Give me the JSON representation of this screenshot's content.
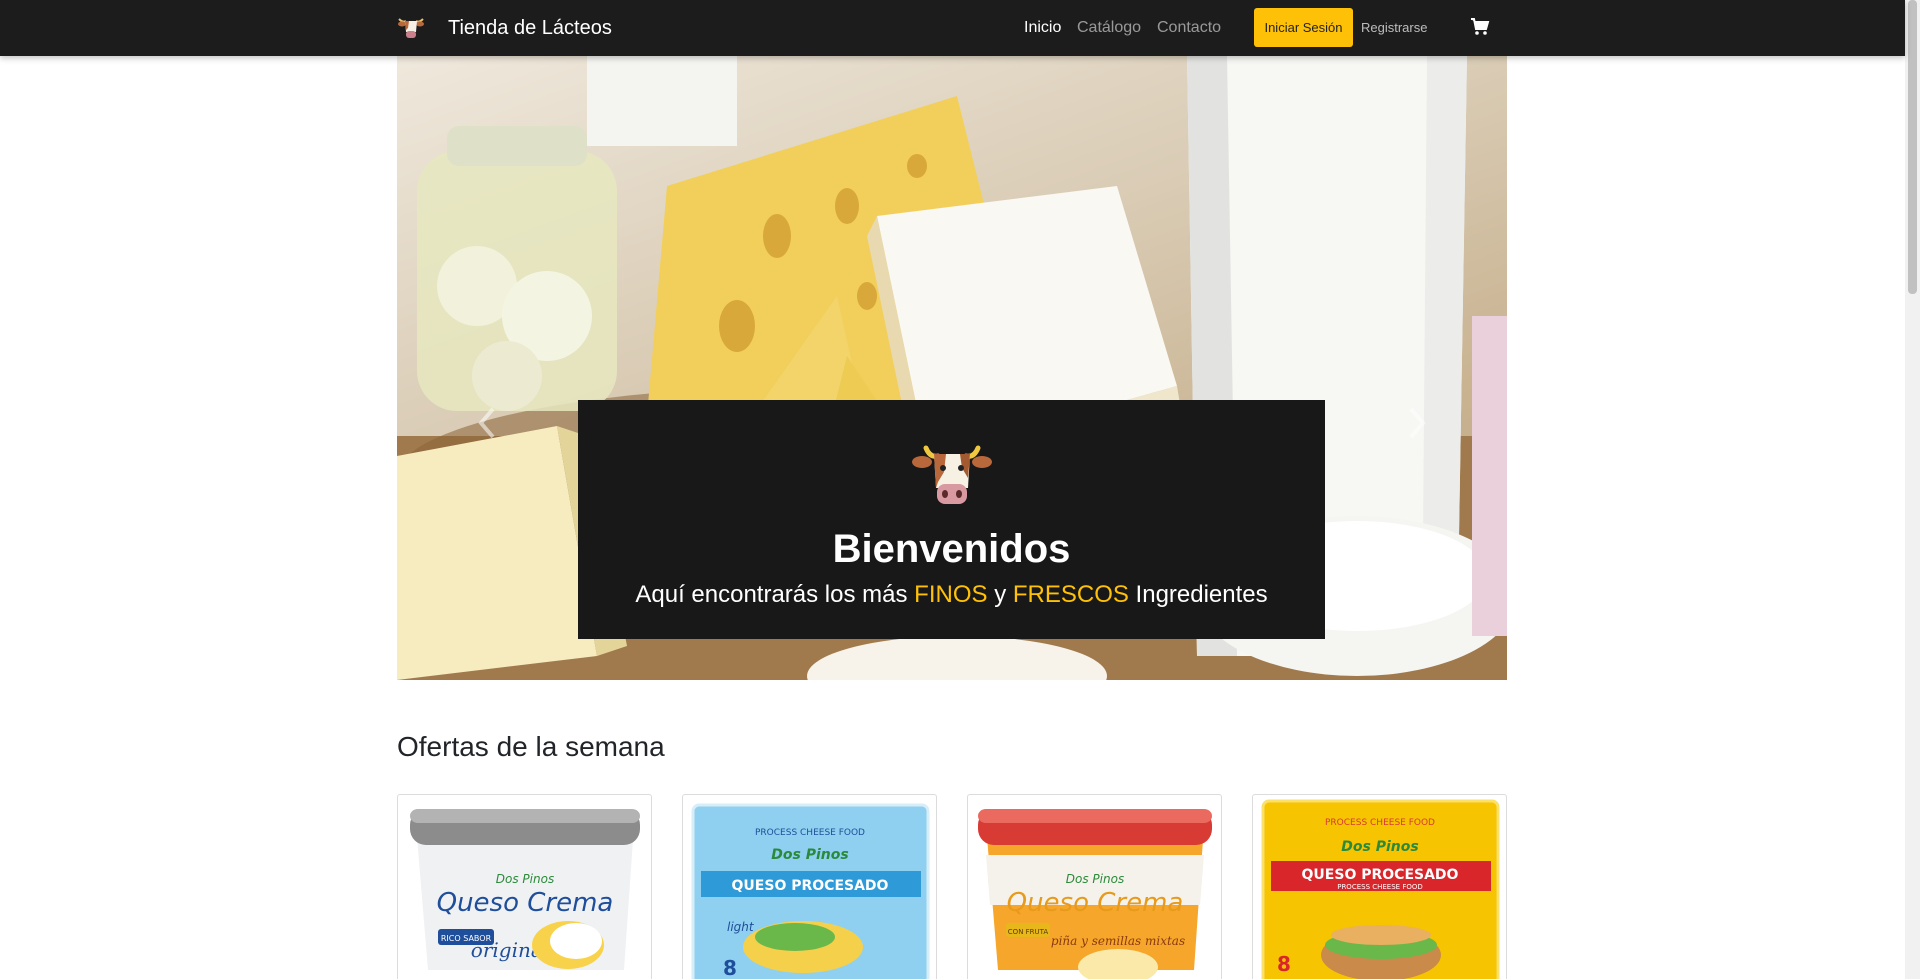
{
  "navbar": {
    "brand": "Tienda de Lácteos",
    "links": [
      "Inicio",
      "Catálogo",
      "Contacto"
    ],
    "active_link": "Inicio",
    "login_label": "Iniciar Sesión",
    "register_label": "Registrarse",
    "cart_icon": "cart-icon",
    "background": "#1c1c1c",
    "accent": "#ffc107"
  },
  "hero": {
    "title": "Bienvenidos",
    "subtitle_before": "Aquí encontrarás los más",
    "highlight_1": "FINOS",
    "connector": "y",
    "highlight_2": "FRESCOS",
    "subtitle_after": "Ingredientes"
  },
  "offers": {
    "title": "Ofertas de la semana",
    "products": [
      {
        "brand": "Dos Pinos",
        "name": "Queso Crema",
        "variant": "original",
        "tag": "RICO SABOR",
        "lid_color": "#8c8c8c"
      },
      {
        "brand": "Dos Pinos",
        "name": "QUESO PROCESADO",
        "variant": "light",
        "tag": "PROCESS CHEESE FOOD",
        "count": "8",
        "pack_color": "#8fd0f0"
      },
      {
        "brand": "Dos Pinos",
        "name": "Queso Crema",
        "variant": "piña y semillas mixtas",
        "tag": "CON FRUTA",
        "lid_color": "#d83a34"
      },
      {
        "brand": "Dos Pinos",
        "name": "QUESO PROCESADO",
        "variant": "PROCESS CHEESE FOOD",
        "tag": "PROCESS CHEESE FOOD",
        "count": "8",
        "pack_color": "#f6c400"
      }
    ]
  }
}
